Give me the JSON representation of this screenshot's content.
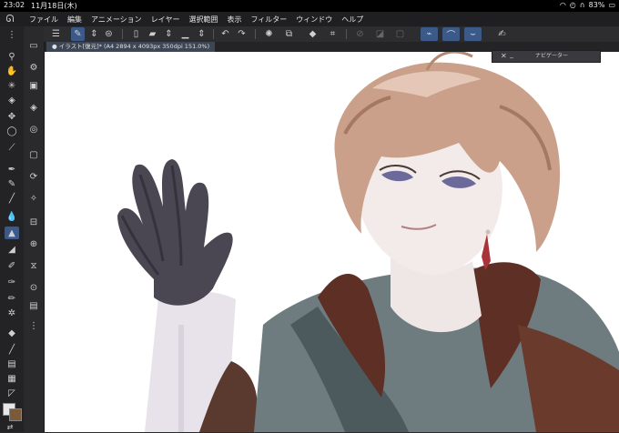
{
  "status": {
    "time": "23:02",
    "date": "11月18日(木)",
    "battery": "83%"
  },
  "menu": [
    "ファイル",
    "編集",
    "アニメーション",
    "レイヤー",
    "選択範囲",
    "表示",
    "フィルター",
    "ウィンドウ",
    "ヘルプ"
  ],
  "tab": {
    "label": "● イラスト[復元]* (A4 2894 x 4093px 350dpi 151.0%)"
  },
  "navigator": {
    "close": "✕",
    "minimize": "_",
    "label": "ナビゲーター"
  },
  "colors": {
    "accent": "#3b5a8a",
    "main_color": "#e8e8e8",
    "sub_color": "#7a5a3a"
  }
}
